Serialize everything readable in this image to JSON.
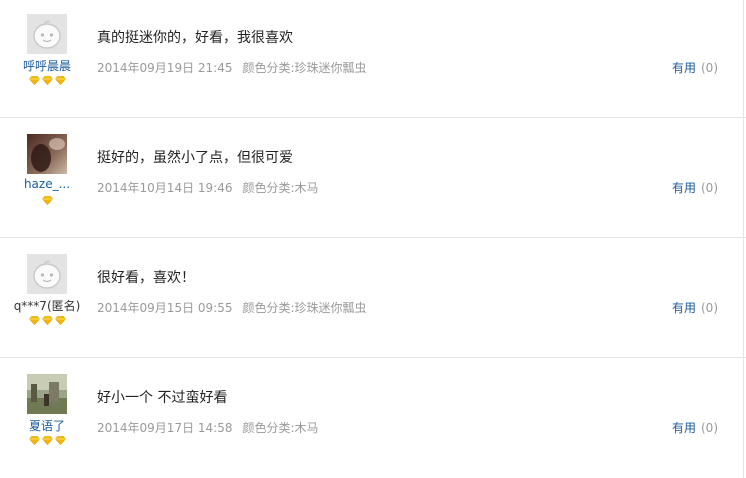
{
  "reviews": [
    {
      "avatar": "default-avatar",
      "username": "呼呼晨晨",
      "anonymous": false,
      "stars": 3,
      "comment": "真的挺迷你的，好看，我很喜欢",
      "date": "2014年09月19日 21:45",
      "spec": "颜色分类:珍珠迷你瓢虫",
      "useful_label": "有用",
      "useful_count": "(0)"
    },
    {
      "avatar": "photo-avatar-dark",
      "username": "haze_...",
      "anonymous": false,
      "stars": 1,
      "comment": "挺好的，虽然小了点，但很可爱",
      "date": "2014年10月14日 19:46",
      "spec": "颜色分类:木马",
      "useful_label": "有用",
      "useful_count": "(0)"
    },
    {
      "avatar": "default-avatar",
      "username": "q***7(匿名)",
      "anonymous": true,
      "stars": 3,
      "comment": "很好看，喜欢！",
      "date": "2014年09月15日 09:55",
      "spec": "颜色分类:珍珠迷你瓢虫",
      "useful_label": "有用",
      "useful_count": "(0)"
    },
    {
      "avatar": "photo-avatar-landscape",
      "username": "夏语了",
      "anonymous": false,
      "stars": 3,
      "comment": "好小一个 不过蛮好看",
      "date": "2014年09月17日 14:58",
      "spec": "颜色分类:木马",
      "useful_label": "有用",
      "useful_count": "(0)"
    }
  ],
  "colors": {
    "link": "#1a5a9e",
    "meta": "#9a9a9a",
    "star": "#f5b800",
    "divider": "#e4e4e4"
  }
}
